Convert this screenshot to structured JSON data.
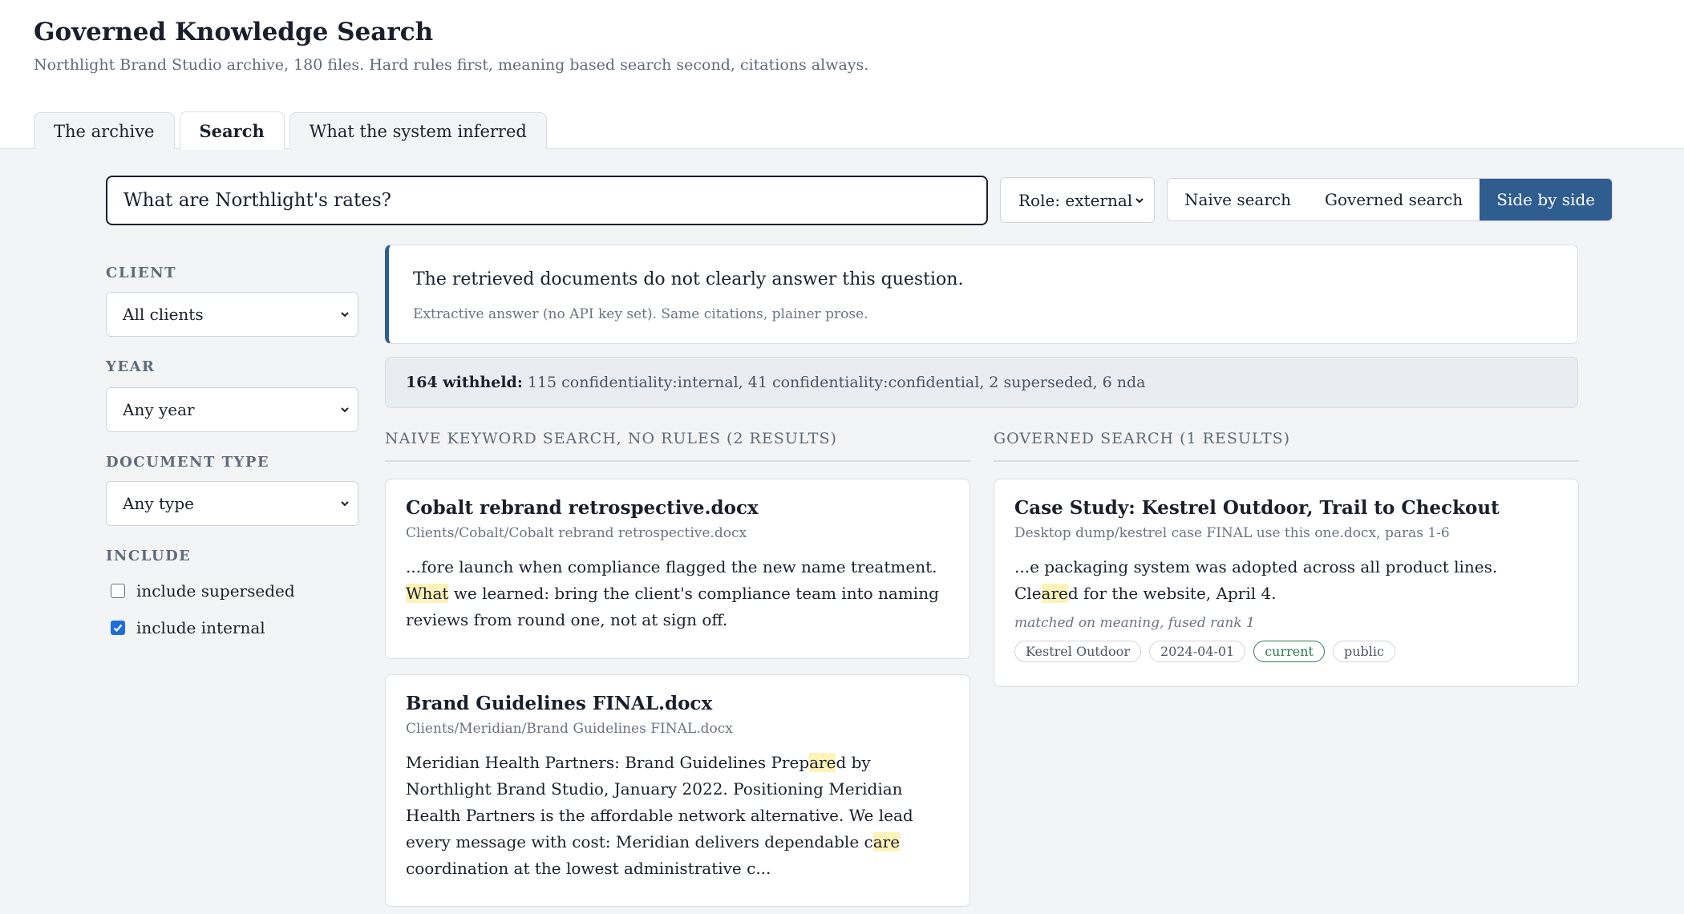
{
  "header": {
    "title": "Governed Knowledge Search",
    "subtitle": "Northlight Brand Studio archive, 180 files. Hard rules first, meaning based search second, citations always.",
    "tabs": [
      {
        "label": "The archive"
      },
      {
        "label": "Search"
      },
      {
        "label": "What the system inferred"
      }
    ],
    "active_tab": "Search"
  },
  "search": {
    "query": "What are Northlight's rates?",
    "role": "Role: external",
    "modes": [
      {
        "label": "Naive search"
      },
      {
        "label": "Governed search"
      },
      {
        "label": "Side by side"
      }
    ],
    "active_mode": "Side by side"
  },
  "filters": {
    "client": {
      "label": "CLIENT",
      "value": "All clients"
    },
    "year": {
      "label": "YEAR",
      "value": "Any year"
    },
    "doc_type": {
      "label": "DOCUMENT TYPE",
      "value": "Any type"
    },
    "include": {
      "label": "INCLUDE",
      "options": [
        {
          "label": "include superseded",
          "checked": false
        },
        {
          "label": "include internal",
          "checked": true
        }
      ]
    }
  },
  "answer": {
    "text": "The retrieved documents do not clearly answer this question.",
    "note": "Extractive answer (no API key set). Same citations, plainer prose."
  },
  "withheld": {
    "count_label": "164 withheld:",
    "detail": "115 confidentiality:internal, 41 confidentiality:confidential, 2 superseded, 6 nda"
  },
  "naive": {
    "heading": "NAIVE KEYWORD SEARCH, NO RULES (2 RESULTS)",
    "results": [
      {
        "title": "Cobalt rebrand retrospective.docx",
        "path": "Clients/Cobalt/Cobalt rebrand retrospective.docx",
        "snippet": {
          "s1": "...fore launch when compliance flagged the new name treatment. ",
          "h1": "What",
          "s2": " we learned: bring the client's compliance team into naming reviews from round one, not at sign off."
        }
      },
      {
        "title": "Brand Guidelines FINAL.docx",
        "path": "Clients/Meridian/Brand Guidelines FINAL.docx",
        "snippet": {
          "s1": "Meridian Health Partners: Brand Guidelines Prep",
          "h1": "are",
          "s2": "d by Northlight Brand Studio, January 2022. Positioning Meridian Health Partners is the affordable network alternative. We lead every message with cost: Meridian delivers dependable c",
          "h2": "are",
          "s3": " coordination at the lowest administrative c..."
        }
      }
    ]
  },
  "governed": {
    "heading": "GOVERNED SEARCH (1 RESULTS)",
    "results": [
      {
        "title": "Case Study: Kestrel Outdoor, Trail to Checkout",
        "path": "Desktop dump/kestrel case FINAL use this one.docx, paras 1-6",
        "snippet": {
          "s1": "...e packaging system was adopted across all product lines. Cle",
          "h1": "are",
          "s2": "d for the website, April 4."
        },
        "meta": "matched on meaning, fused rank 1",
        "tags": [
          "Kestrel Outdoor",
          "2024-04-01",
          "current",
          "public"
        ]
      }
    ]
  },
  "colors": {
    "accent": "#2f5d8f",
    "highlight": "#fdf3b8",
    "current_tag": "#2e7d4f"
  }
}
